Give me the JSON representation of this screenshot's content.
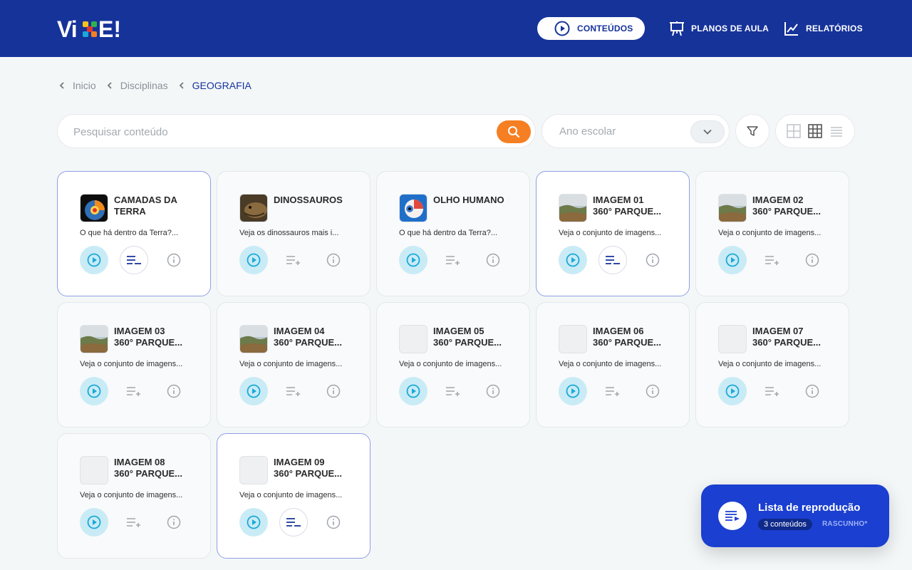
{
  "header": {
    "logo_text": "VIXE!",
    "nav": {
      "contents": "CONTEÚDOS",
      "lesson_plans": "PLANOS DE AULA",
      "reports": "RELATÓRIOS"
    }
  },
  "breadcrumb": [
    "Inicio",
    "Disciplinas",
    "GEOGRAFIA"
  ],
  "search": {
    "placeholder": "Pesquisar conteúdo"
  },
  "year_select": {
    "placeholder": "Ano escolar"
  },
  "cards": [
    {
      "title": [
        "CAMADAS DA",
        "TERRA"
      ],
      "desc": "O que há dentro da Terra?...",
      "thumb": "earth",
      "in_playlist": true
    },
    {
      "title": [
        "DINOSSAUROS"
      ],
      "desc": "Veja os dinossauros mais i...",
      "thumb": "dino",
      "in_playlist": false
    },
    {
      "title": [
        "OLHO HUMANO"
      ],
      "desc": "O que há dentro da Terra?...",
      "thumb": "eye",
      "in_playlist": false
    },
    {
      "title": [
        "IMAGEM 01",
        "360° PARQUE..."
      ],
      "desc": "Veja o conjunto de imagens...",
      "thumb": "landscape",
      "in_playlist": true
    },
    {
      "title": [
        "IMAGEM 02",
        "360° PARQUE..."
      ],
      "desc": "Veja o conjunto de imagens...",
      "thumb": "landscape",
      "in_playlist": false
    },
    {
      "title": [
        "IMAGEM 03",
        "360° PARQUE..."
      ],
      "desc": "Veja o conjunto de imagens...",
      "thumb": "landscape",
      "in_playlist": false
    },
    {
      "title": [
        "IMAGEM 04",
        "360° PARQUE..."
      ],
      "desc": "Veja o conjunto de imagens...",
      "thumb": "landscape",
      "in_playlist": false
    },
    {
      "title": [
        "IMAGEM 05",
        "360° PARQUE..."
      ],
      "desc": "Veja o conjunto de imagens...",
      "thumb": "blank",
      "in_playlist": false
    },
    {
      "title": [
        "IMAGEM 06",
        "360° PARQUE..."
      ],
      "desc": "Veja o conjunto de imagens...",
      "thumb": "blank",
      "in_playlist": false
    },
    {
      "title": [
        "IMAGEM 07",
        "360° PARQUE..."
      ],
      "desc": "Veja o conjunto de imagens...",
      "thumb": "blank",
      "in_playlist": false
    },
    {
      "title": [
        "IMAGEM 08",
        "360° PARQUE..."
      ],
      "desc": "Veja o conjunto de imagens...",
      "thumb": "blank",
      "in_playlist": false
    },
    {
      "title": [
        "IMAGEM 09",
        "360° PARQUE..."
      ],
      "desc": "Veja o conjunto de imagens...",
      "thumb": "blank",
      "in_playlist": true
    }
  ],
  "playlist": {
    "title": "Lista de reprodução",
    "count": "3 conteúdos",
    "status": "RASCUNHO*"
  },
  "colors": {
    "header_bg": "#16339a",
    "accent_orange": "#f57f22",
    "play_blue": "#1aa9d8",
    "playlist_bg": "#1b3fd0"
  }
}
